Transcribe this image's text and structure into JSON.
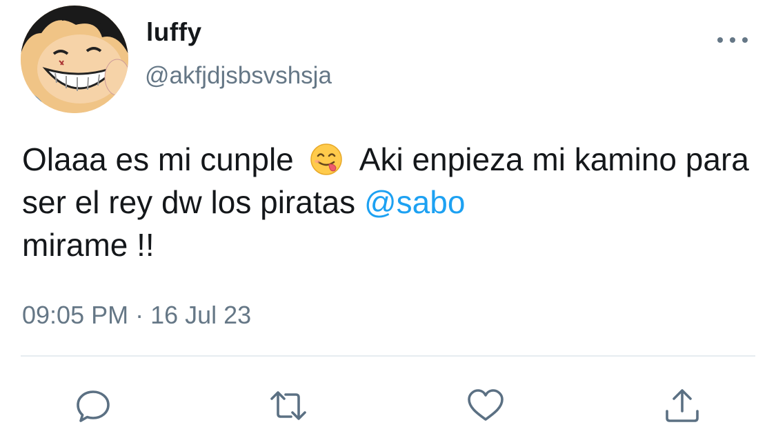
{
  "user": {
    "display_name": "luffy",
    "handle": "@akfjdjsbsvshsja"
  },
  "tweet": {
    "text_part1": "Olaaa es mi cunple",
    "emoji_name": "smiling-face-savoring-food-emoji",
    "text_part2": "Aki enpieza mi kamino para ser el rey dw los piratas",
    "mention": "@sabo",
    "text_part3": "mirame !!",
    "timestamp": "09:05 PM · 16 Jul 23"
  },
  "actions": {
    "reply_icon": "reply-icon",
    "retweet_icon": "retweet-icon",
    "like_icon": "heart-icon",
    "share_icon": "share-icon",
    "more_icon": "more-icon"
  },
  "colors": {
    "text": "#14171a",
    "secondary": "#657786",
    "link": "#1da1f2",
    "divider": "#e6ecf0",
    "icon": "#5b7083"
  }
}
